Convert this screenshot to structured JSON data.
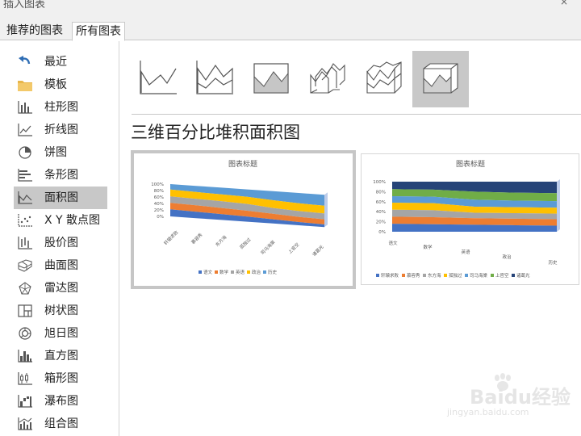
{
  "window": {
    "title": "插入图表",
    "close_symbol": "×"
  },
  "tabs": [
    {
      "label": "推荐的图表",
      "active": false
    },
    {
      "label": "所有图表",
      "active": true
    }
  ],
  "sidebar": {
    "items": [
      {
        "label": "最近",
        "icon": "undo-arrow-icon"
      },
      {
        "label": "模板",
        "icon": "folder-icon"
      },
      {
        "label": "柱形图",
        "icon": "column-chart-icon"
      },
      {
        "label": "折线图",
        "icon": "line-chart-icon"
      },
      {
        "label": "饼图",
        "icon": "pie-chart-icon"
      },
      {
        "label": "条形图",
        "icon": "bar-chart-icon"
      },
      {
        "label": "面积图",
        "icon": "area-chart-icon",
        "selected": true
      },
      {
        "label": "X Y 散点图",
        "icon": "scatter-chart-icon"
      },
      {
        "label": "股价图",
        "icon": "stock-chart-icon"
      },
      {
        "label": "曲面图",
        "icon": "surface-chart-icon"
      },
      {
        "label": "雷达图",
        "icon": "radar-chart-icon"
      },
      {
        "label": "树状图",
        "icon": "treemap-chart-icon"
      },
      {
        "label": "旭日图",
        "icon": "sunburst-chart-icon"
      },
      {
        "label": "直方图",
        "icon": "histogram-chart-icon"
      },
      {
        "label": "箱形图",
        "icon": "box-whisker-chart-icon"
      },
      {
        "label": "瀑布图",
        "icon": "waterfall-chart-icon"
      },
      {
        "label": "组合图",
        "icon": "combo-chart-icon"
      }
    ]
  },
  "variants": [
    {
      "name": "area",
      "selected": false
    },
    {
      "name": "stacked-area",
      "selected": false
    },
    {
      "name": "100-percent-stacked-area",
      "selected": false
    },
    {
      "name": "3d-area",
      "selected": false
    },
    {
      "name": "3d-stacked-area",
      "selected": false
    },
    {
      "name": "3d-100-percent-stacked-area",
      "selected": true
    }
  ],
  "selected_title": "三维百分比堆积面积图",
  "colors": {
    "series": [
      "#4472c4",
      "#ed7d31",
      "#a5a5a5",
      "#ffc000",
      "#5b9bd5",
      "#70ad47",
      "#264478"
    ],
    "selected_bg": "#c8c8c8"
  },
  "previews": [
    {
      "title": "图表标题",
      "y_ticks": [
        "100%",
        "80%",
        "60%",
        "40%",
        "20%",
        "0%"
      ],
      "categories": [
        "轩辕求败",
        "慕容秀",
        "东方海",
        "孤独过",
        "司马海棠",
        "上官空",
        "诸葛光"
      ],
      "legend": [
        "语文",
        "数学",
        "英语",
        "政治",
        "历史"
      ]
    },
    {
      "title": "图表标题",
      "y_ticks": [
        "100%",
        "80%",
        "60%",
        "40%",
        "20%",
        "0%"
      ],
      "categories": [
        "语文",
        "数学",
        "英语",
        "政治",
        "历史"
      ],
      "legend": [
        "轩辕求败",
        "慕容秀",
        "东方海",
        "孤独过",
        "司马海棠",
        "上官空",
        "诸葛光"
      ]
    }
  ],
  "watermark": {
    "brand": "Baidu经验",
    "url": "jingyan.baidu.com"
  }
}
